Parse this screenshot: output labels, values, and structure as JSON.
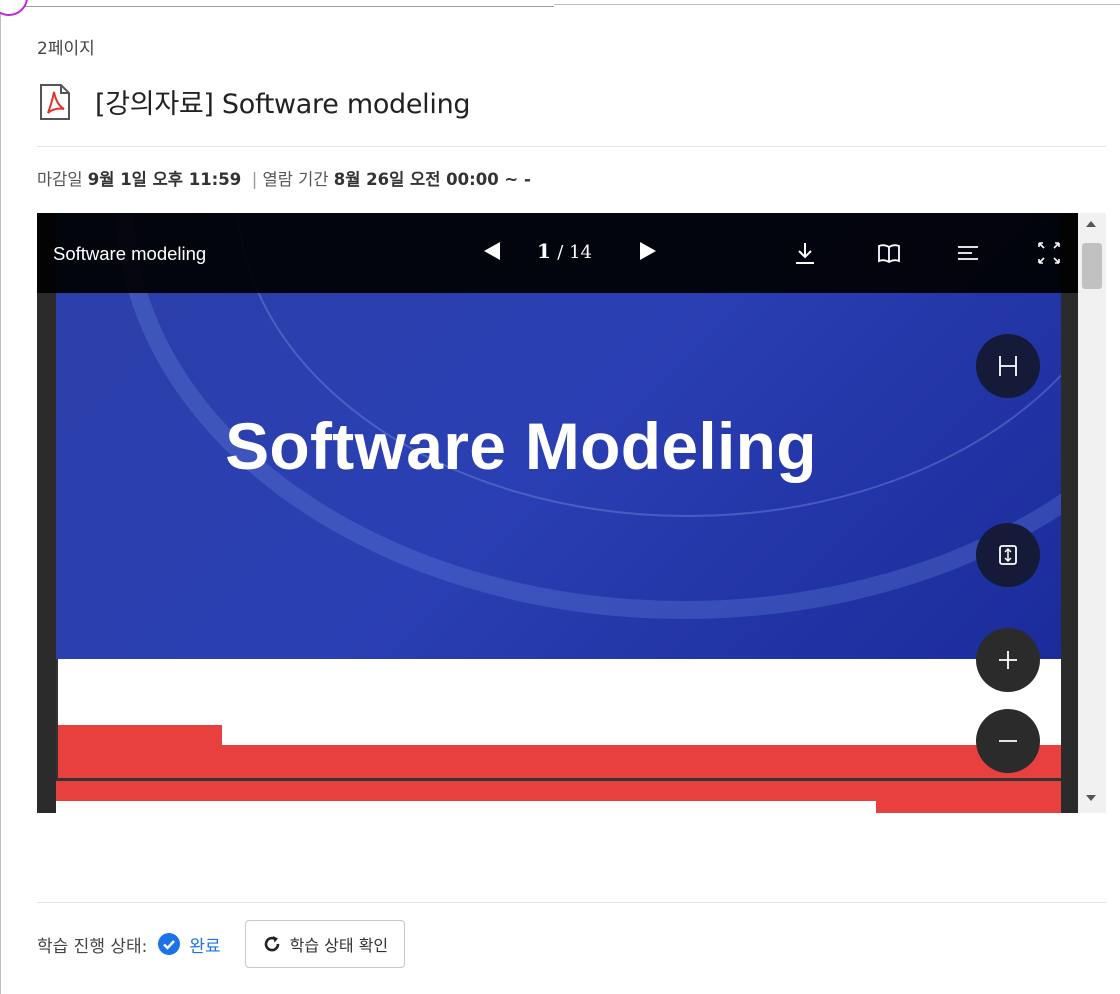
{
  "page_label": "2페이지",
  "document": {
    "title": "[강의자료] Software modeling",
    "file_type_icon": "pdf-icon"
  },
  "meta": {
    "deadline_label": "마감일",
    "deadline_value": "9월 1일 오후 11:59",
    "separator": "|",
    "view_period_label": "열람 기간",
    "view_period_value": "8월 26일 오전 00:00 ~ -"
  },
  "viewer": {
    "title": "Software modeling",
    "current_page": "1",
    "total_pages": "/ 14",
    "icons": [
      "download-icon",
      "book-icon",
      "menu-icon",
      "fullscreen-icon"
    ],
    "float_buttons": [
      "fit-width-icon",
      "fit-height-icon",
      "zoom-in-icon",
      "zoom-out-icon"
    ]
  },
  "slide": {
    "title": "Software Modeling"
  },
  "status": {
    "label": "학습 진행 상태:",
    "value": "완료",
    "refresh_button_label": "학습 상태 확인"
  },
  "colors": {
    "accent_blue": "#1a73e8",
    "slide_blue": "#2a3fb3",
    "slide_red": "#e8403f",
    "toolbar_bg": "#000000"
  }
}
